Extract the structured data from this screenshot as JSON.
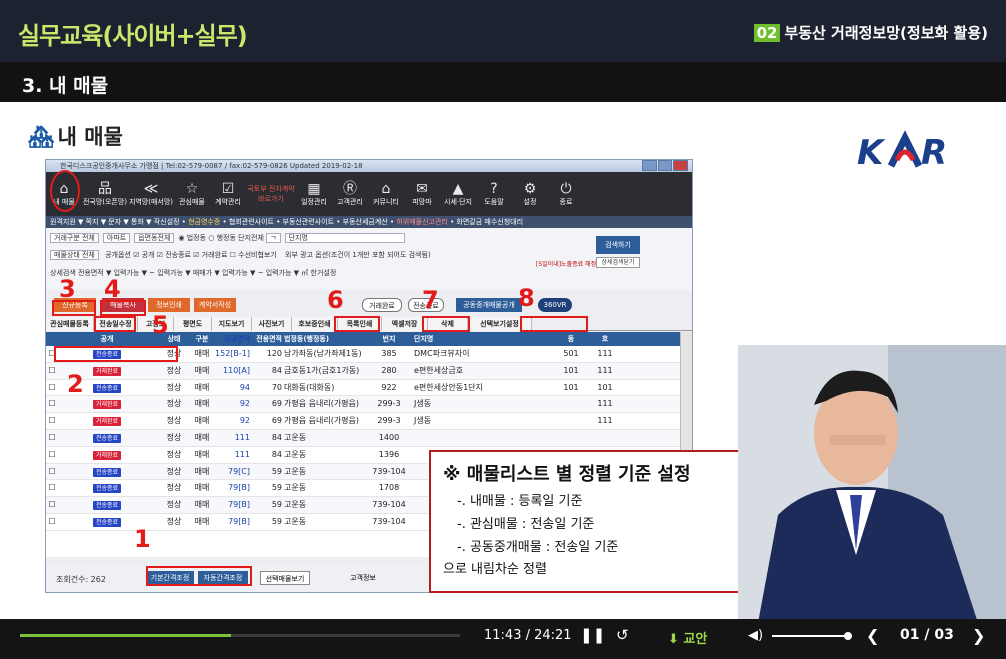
{
  "header": {
    "course_title": "실무교육(사이버+실무)",
    "chapter_num": "02",
    "chapter_title": "부동산 거래정보망(정보화 활용)"
  },
  "section": {
    "title": "3. 내 매물"
  },
  "page": {
    "heading": "내 매물",
    "heading_icon": "house-icon"
  },
  "window": {
    "title": "한국디스크공인중개사무소 가맹점 | Tel:02-579-0087 / fax:02-579-0826 Updated 2019-02-18"
  },
  "toolbar": [
    {
      "icon": "home-icon",
      "glyph": "⌂",
      "label": "내 매물"
    },
    {
      "icon": "sitemap-icon",
      "glyph": "品",
      "label": "전국망(오픈망)"
    },
    {
      "icon": "share-icon",
      "glyph": "≪",
      "label": "지역망(매서망)"
    },
    {
      "icon": "star-icon",
      "glyph": "☆",
      "label": "관심매물"
    },
    {
      "icon": "contract-icon",
      "glyph": "☑",
      "label": "계약관리"
    },
    {
      "icon": "e-contract-icon",
      "glyph": "",
      "label": "국토부 전자계약 바로가기"
    },
    {
      "icon": "calendar-icon",
      "glyph": "▦",
      "label": "일정관리"
    },
    {
      "icon": "customers-icon",
      "glyph": "Ⓡ",
      "label": "고객관리"
    },
    {
      "icon": "community-icon",
      "glyph": "⌂",
      "label": "커뮤니티"
    },
    {
      "icon": "megaphone-icon",
      "glyph": "✉",
      "label": "피망마"
    },
    {
      "icon": "chart-icon",
      "glyph": "▲",
      "label": "시세·단지"
    },
    {
      "icon": "help-icon",
      "glyph": "?",
      "label": "도움말"
    },
    {
      "icon": "settings-icon",
      "glyph": "⚙",
      "label": "설정"
    },
    {
      "icon": "power-icon",
      "glyph": "⏻",
      "label": "종료"
    }
  ],
  "menubar": {
    "items": "원격지원 ▼ 쪽지 ▼ 문자 ▼ 통화 ▼ 작신설정 •",
    "highlight": "현금영수증",
    "links": "• 협회관련사이트 • 부동산관련사이트 • 부동산세금계산 •",
    "alert": "허위매물신고관리",
    "tail": "• 화면갈금  매수신청대리"
  },
  "filters": {
    "row1": [
      "거래구분 전체",
      "아파트",
      "읍면동전체",
      "◉ 법정동 ○ 행정동  단지전체",
      "ㄱ",
      "단지명",
      "ㄴ"
    ],
    "row2_label": "매물상태 전체",
    "row2_opts": "공개옵션 ☑ 공개 ☑ 전송종료 ☑ 거래완료 ☐ 수선비협보기",
    "row2_more": "외부 광고 옵션(조건이 1개만 포함 되어도 검색됨)",
    "row3": "상세검색  전용면적 ▼  입력가능 ▼ ~  입력가능 ▼  매매가 ▼  입력가능 ▼ ~  입력가능 ▼  ㎡  한거설정",
    "find_label": "검색하기",
    "detail_label": "상세검색닫기",
    "expire_label": "[5일이내]노출종료 해정 확인보기"
  },
  "actions": {
    "new": "신규등록",
    "copy": "매물복사",
    "print": "정보인쇄",
    "contract": "계약서작성",
    "done": "거래완료",
    "transfer": "전송종료",
    "share": "공동중개매물공개",
    "vr": "360VR"
  },
  "tabs": [
    "관심매물등록",
    "전송일수정",
    "고정보",
    "평면도",
    "지도보기",
    "사진보기",
    "호보증인쇄",
    "목록인쇄",
    "엑셀저장",
    "삭제",
    "선택보기설정"
  ],
  "grid": {
    "headers": [
      "",
      "공개",
      "상태",
      "구분",
      "공급면적",
      "전용면적",
      "법정동(행정동)",
      "번지",
      "단지명",
      "동",
      "호"
    ],
    "rows": [
      {
        "tag": "전송종료",
        "tag_color": "#2746c4",
        "status": "정상",
        "type": "매매",
        "supply": "152[B-1]",
        "excl": "120",
        "dong": "남가좌동(남가좌제1동)",
        "bunji": "385",
        "complex": "DMC파크뷰자이",
        "d": "501",
        "h": "111"
      },
      {
        "tag": "거래완료",
        "tag_color": "#d9213a",
        "status": "정상",
        "type": "매매",
        "supply": "110[A]",
        "excl": "84",
        "dong": "금호동1가(금호1가동)",
        "bunji": "280",
        "complex": "e편한세상금호",
        "d": "101",
        "h": "111"
      },
      {
        "tag": "전송종료",
        "tag_color": "#2746c4",
        "status": "정상",
        "type": "매매",
        "supply": "94",
        "excl": "70",
        "dong": "대화동(대화동)",
        "bunji": "922",
        "complex": "e편한세상안동1단지",
        "d": "101",
        "h": "101"
      },
      {
        "tag": "거래완료",
        "tag_color": "#d9213a",
        "status": "정상",
        "type": "매매",
        "supply": "92",
        "excl": "69",
        "dong": "가평읍 읍내리(가평읍)",
        "bunji": "299-3",
        "complex": "J생동",
        "d": "",
        "h": "111"
      },
      {
        "tag": "거래완료",
        "tag_color": "#d9213a",
        "status": "정상",
        "type": "매매",
        "supply": "92",
        "excl": "69",
        "dong": "가평읍 읍내리(가평읍)",
        "bunji": "299-3",
        "complex": "J생동",
        "d": "",
        "h": "111"
      },
      {
        "tag": "전송종료",
        "tag_color": "#2746c4",
        "status": "정상",
        "type": "매매",
        "supply": "111",
        "excl": "84",
        "dong": "고운동",
        "bunji": "1400",
        "complex": "",
        "d": "",
        "h": ""
      },
      {
        "tag": "거래완료",
        "tag_color": "#d9213a",
        "status": "정상",
        "type": "매매",
        "supply": "111",
        "excl": "84",
        "dong": "고운동",
        "bunji": "1396",
        "complex": "",
        "d": "",
        "h": ""
      },
      {
        "tag": "전송종료",
        "tag_color": "#2746c4",
        "status": "정상",
        "type": "매매",
        "supply": "79[C]",
        "excl": "59",
        "dong": "고운동",
        "bunji": "739-104",
        "complex": "",
        "d": "",
        "h": ""
      },
      {
        "tag": "전송종료",
        "tag_color": "#2746c4",
        "status": "정상",
        "type": "매매",
        "supply": "79[B]",
        "excl": "59",
        "dong": "고운동",
        "bunji": "1708",
        "complex": "",
        "d": "",
        "h": ""
      },
      {
        "tag": "전송종료",
        "tag_color": "#2746c4",
        "status": "정상",
        "type": "매매",
        "supply": "79[B]",
        "excl": "59",
        "dong": "고운동",
        "bunji": "739-104",
        "complex": "",
        "d": "",
        "h": ""
      },
      {
        "tag": "전송종료",
        "tag_color": "#2746c4",
        "status": "정상",
        "type": "매매",
        "supply": "79[B]",
        "excl": "59",
        "dong": "고운동",
        "bunji": "739-104",
        "complex": "",
        "d": "",
        "h": ""
      }
    ]
  },
  "bottom": {
    "count": "조회건수: 262",
    "basic": "기본간격조정",
    "auto": "자동간격조정",
    "select": "선택매물보기",
    "customer": "고객정보"
  },
  "annotations": [
    "1",
    "2",
    "3",
    "4",
    "5",
    "6",
    "7",
    "8"
  ],
  "note": {
    "title": "※ 매물리스트 별 정렬 기준 설정",
    "lines": [
      "-. 내매물 : 등록일 기준",
      "-. 관심매물 : 전송일 기준",
      "-. 공동중개매물 : 전송일 기준"
    ],
    "footer": "으로 내림차순 정렬"
  },
  "player": {
    "time": "11:43 / 24:21",
    "progress": 0.48,
    "download": "교안",
    "pages": "01 / 03"
  }
}
